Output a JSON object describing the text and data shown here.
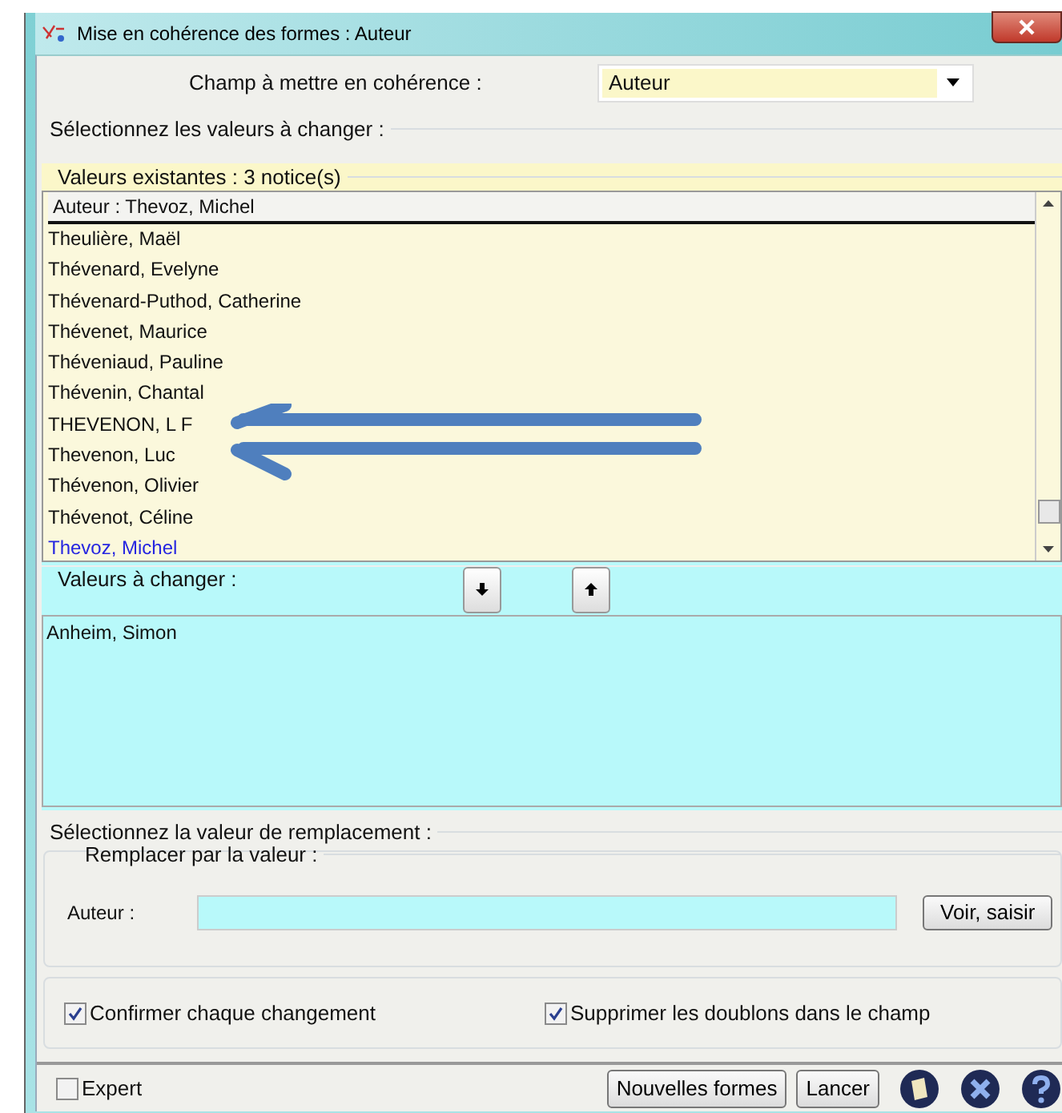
{
  "window": {
    "title": "Mise en cohérence des formes :  Auteur"
  },
  "field_select": {
    "label": "Champ à mettre en cohérence :",
    "value": "Auteur"
  },
  "select_section": {
    "title": "Sélectionnez les valeurs à changer :"
  },
  "existing": {
    "title": "Valeurs existantes : 3 notice(s)",
    "header": "Auteur  : Thevoz, Michel",
    "items": [
      {
        "text": "Theulière, Maël",
        "highlighted": false
      },
      {
        "text": "Thévenard, Evelyne",
        "highlighted": false
      },
      {
        "text": "Thévenard-Puthod, Catherine",
        "highlighted": false
      },
      {
        "text": "Thévenet, Maurice",
        "highlighted": false
      },
      {
        "text": "Théveniaud, Pauline",
        "highlighted": false
      },
      {
        "text": "Thévenin, Chantal",
        "highlighted": false
      },
      {
        "text": "THEVENON, L F",
        "highlighted": false
      },
      {
        "text": "Thevenon, Luc",
        "highlighted": false
      },
      {
        "text": "Thévenon, Olivier",
        "highlighted": false
      },
      {
        "text": "Thévenot, Céline",
        "highlighted": false
      },
      {
        "text": "Thevoz, Michel",
        "highlighted": true
      }
    ]
  },
  "to_change": {
    "title": "Valeurs à changer :",
    "items": [
      "Anheim, Simon"
    ]
  },
  "replacement": {
    "title": "Sélectionnez la valeur de remplacement :",
    "subtitle": "Remplacer par la valeur :",
    "label": "Auteur  :",
    "button": "Voir, saisir"
  },
  "options": [
    {
      "label": "Confirmer chaque changement",
      "checked": true
    },
    {
      "label": "Supprimer les doublons dans le champ",
      "checked": true
    }
  ],
  "footer": {
    "expert": {
      "label": "Expert",
      "checked": false
    },
    "buttons": [
      "Nouvelles formes",
      "Lancer"
    ]
  }
}
